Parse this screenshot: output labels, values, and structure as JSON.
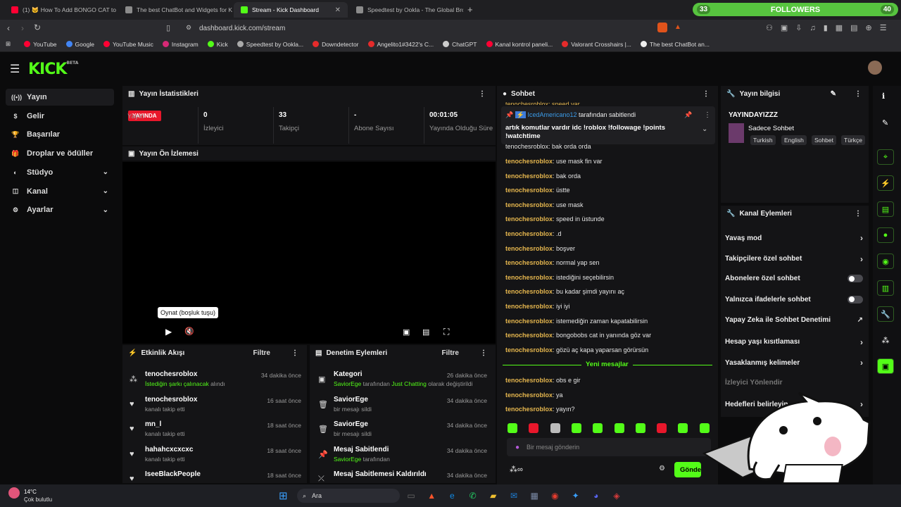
{
  "browser": {
    "tabs": [
      {
        "label": "(1) 🐱 How To Add BONGO CAT to O",
        "color": "#ff0033"
      },
      {
        "label": "The best ChatBot and Widgets for Ki",
        "color": "#8b8b8b"
      },
      {
        "label": "Stream - Kick Dashboard",
        "color": "#53fc18"
      },
      {
        "label": "Speedtest by Ookla - The Global Broa",
        "color": "#8b8b8b"
      }
    ],
    "new_tab": "+",
    "url": "dashboard.kick.com/stream",
    "bookmarks": [
      {
        "label": "YouTube",
        "color": "#ff0033"
      },
      {
        "label": "Google",
        "color": "#4285f4"
      },
      {
        "label": "YouTube Music",
        "color": "#ff0033"
      },
      {
        "label": "Instagram",
        "color": "#d62976"
      },
      {
        "label": "Kick",
        "color": "#53fc18"
      },
      {
        "label": "Speedtest by Ookla...",
        "color": "#aaaaaa"
      },
      {
        "label": "Downdetector",
        "color": "#e52b2b"
      },
      {
        "label": "Angelito1#3422's C...",
        "color": "#e52b2b"
      },
      {
        "label": "ChatGPT",
        "color": "#cccccc"
      },
      {
        "label": "Kanal kontrol paneli...",
        "color": "#ff0033"
      },
      {
        "label": "Valorant Crosshairs |...",
        "color": "#e52b2b"
      },
      {
        "label": "The best ChatBot an...",
        "color": "#eeeeee"
      }
    ]
  },
  "followers_widget": {
    "left": "33",
    "label": "FOLLOWERS",
    "right": "40"
  },
  "brand": {
    "name": "KICK",
    "tag": "BETA"
  },
  "sidebar": [
    {
      "label": "Yayın",
      "icon": "stream-icon"
    },
    {
      "label": "Gelir",
      "icon": "revenue-icon"
    },
    {
      "label": "Başarılar",
      "icon": "trophy-icon"
    },
    {
      "label": "Droplar ve ödüller",
      "icon": "gift-icon"
    },
    {
      "label": "Stüdyo",
      "icon": "studio-icon"
    },
    {
      "label": "Kanal",
      "icon": "channel-icon"
    },
    {
      "label": "Ayarlar",
      "icon": "settings-icon"
    }
  ],
  "stats": {
    "title": "Yayın İstatistikleri",
    "badge": "YAYINDA",
    "items": [
      {
        "value": "",
        "label": "Yayın"
      },
      {
        "value": "0",
        "label": "İzleyici"
      },
      {
        "value": "33",
        "label": "Takipçi"
      },
      {
        "value": "-",
        "label": "Abone Sayısı"
      },
      {
        "value": "00:01:05",
        "label": "Yayında Olduğu Süre"
      }
    ]
  },
  "preview": {
    "title": "Yayın Ön İzlemesi",
    "tooltip": "Oynat (boşluk tuşu)"
  },
  "activity": {
    "title": "Etkinlik Akışı",
    "filter": "Filtre",
    "items": [
      {
        "name": "tenochesroblox",
        "detail": "İstediğin şarkı çalınacak",
        "detail2": " alındı",
        "time": "34 dakika önce"
      },
      {
        "name": "tenochesroblox",
        "detail": "kanalı takip etti",
        "detail2": "",
        "time": "16 saat önce"
      },
      {
        "name": "mn_l",
        "detail": "kanalı takip etti",
        "detail2": "",
        "time": "18 saat önce"
      },
      {
        "name": "hahahcxcxcxc",
        "detail": "kanalı takip etti",
        "detail2": "",
        "time": "18 saat önce"
      },
      {
        "name": "IseeBlackPeople",
        "detail": "",
        "detail2": "",
        "time": "18 saat önce"
      }
    ]
  },
  "moderation": {
    "title": "Denetim Eylemleri",
    "filter": "Filtre",
    "items": [
      {
        "name": "Kategori",
        "user": "SaviorEge",
        "detail": " tarafından ",
        "extra": "Just Chatting",
        "detail2": " olarak değiştirildi",
        "time": "26 dakika önce"
      },
      {
        "name": "SaviorEge",
        "user": "",
        "detail": "bir mesajı sildi",
        "extra": "",
        "detail2": "",
        "time": "34 dakika önce"
      },
      {
        "name": "SaviorEge",
        "user": "",
        "detail": "bir mesajı sildi",
        "extra": "",
        "detail2": "",
        "time": "34 dakika önce"
      },
      {
        "name": "Mesaj Sabitlendi",
        "user": "SaviorEge",
        "detail": " tarafından",
        "extra": "",
        "detail2": "",
        "time": "34 dakika önce"
      },
      {
        "name": "Mesaj Sabitlemesi Kaldırıldı",
        "user": "",
        "detail": "",
        "extra": "",
        "detail2": "",
        "time": "34 dakika önce"
      }
    ]
  },
  "chat": {
    "title": "Sohbet",
    "pinned_user": "IcedAmericano12",
    "pinned_by": " tarafından sabitlendi",
    "pinned_text": "artık komutlar vardır idc !roblox !followage !points !watchtime",
    "top_partial": "tenochesroblox: speed var",
    "partial2": "tenochesroblox: bak orda orda",
    "user": "tenochesroblox",
    "messages": [
      ": use mask fin var",
      ": bak orda",
      ": üstte",
      ": use mask",
      ": speed in üstunde",
      ": .d",
      ": boşver",
      ": normal yap sen",
      ": istediğini seçebilirsin",
      ": bu kadar şimdi yayını aç",
      ": iyi iyi",
      ": istemediğin zaman kapatabilirsin",
      ": bongobobs cat in yanında göz var",
      ": gözü aç kapa yaparsan görürsün"
    ],
    "new_label": "Yeni mesajlar",
    "new_messages": [
      ": obs e gir",
      ": ya",
      ": yayın?"
    ],
    "input_placeholder": "Bir mesaj gönderin",
    "send": "Gönder"
  },
  "info": {
    "title": "Yayın bilgisi",
    "stream_title": "YAYINDAYIZZZ",
    "category": "Sadece Sohbet",
    "tags": [
      "Turkish",
      "English",
      "Sohbet",
      "Türkçe"
    ]
  },
  "channel_actions": {
    "title": "Kanal Eylemleri",
    "items": [
      {
        "label": "Yavaş mod",
        "kind": "arrow"
      },
      {
        "label": "Takipçilere özel sohbet",
        "kind": "arrow"
      },
      {
        "label": "Abonelere özel sohbet",
        "kind": "toggle"
      },
      {
        "label": "Yalnızca ifadelerle sohbet",
        "kind": "toggle"
      },
      {
        "label": "Yapay Zeka ile Sohbet Denetimi",
        "kind": "ext"
      },
      {
        "label": "Hesap yaşı kısıtlaması",
        "kind": "arrow"
      },
      {
        "label": "Yasaklanmış kelimeler",
        "kind": "arrow"
      },
      {
        "label": "İzleyici Yönlendir",
        "kind": "none"
      },
      {
        "label": "Hedefleri belirleyin",
        "kind": "arrow"
      }
    ]
  },
  "taskbar": {
    "temp": "14°C",
    "weather": "Çok bulutlu",
    "search": "Ara"
  }
}
